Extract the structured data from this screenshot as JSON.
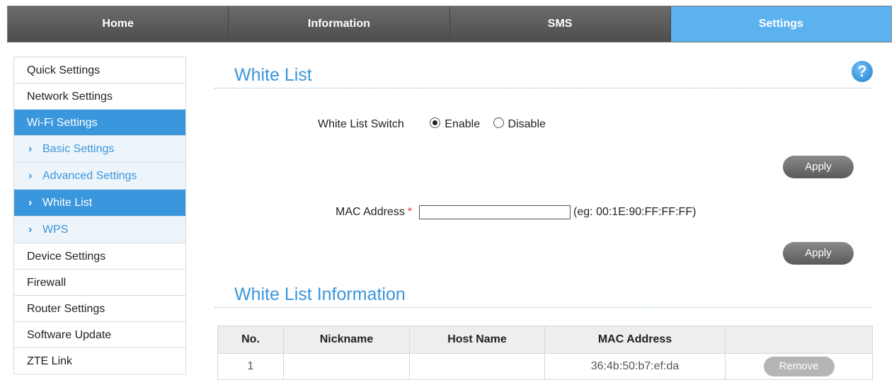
{
  "nav": {
    "tabs": [
      {
        "label": "Home"
      },
      {
        "label": "Information"
      },
      {
        "label": "SMS"
      },
      {
        "label": "Settings"
      }
    ]
  },
  "sidebar": {
    "items": [
      {
        "label": "Quick Settings"
      },
      {
        "label": "Network Settings"
      },
      {
        "label": "Wi-Fi Settings"
      },
      {
        "label": "Basic Settings"
      },
      {
        "label": "Advanced Settings"
      },
      {
        "label": "White List"
      },
      {
        "label": "WPS"
      },
      {
        "label": "Device Settings"
      },
      {
        "label": "Firewall"
      },
      {
        "label": "Router Settings"
      },
      {
        "label": "Software Update"
      },
      {
        "label": "ZTE Link"
      }
    ]
  },
  "main": {
    "title": "White List",
    "help_glyph": "?",
    "switch_label": "White List Switch",
    "enable_label": "Enable",
    "disable_label": "Disable",
    "switch_selected": "Enable",
    "apply_label": "Apply",
    "mac_label": "MAC Address",
    "mac_required": "*",
    "mac_value": "",
    "mac_hint": "(eg: 00:1E:90:FF:FF:FF)",
    "info_title": "White List Information",
    "table": {
      "headers": [
        "No.",
        "Nickname",
        "Host Name",
        "MAC Address",
        ""
      ],
      "rows": [
        {
          "no": "1",
          "nickname": "",
          "host_name": "",
          "mac": "36:4b:50:b7:ef:da",
          "action": "Remove"
        }
      ]
    }
  },
  "colors": {
    "accent": "#3a96dd",
    "nav_active": "#5bb2ef",
    "nav_bg": "#5a5a5a"
  }
}
